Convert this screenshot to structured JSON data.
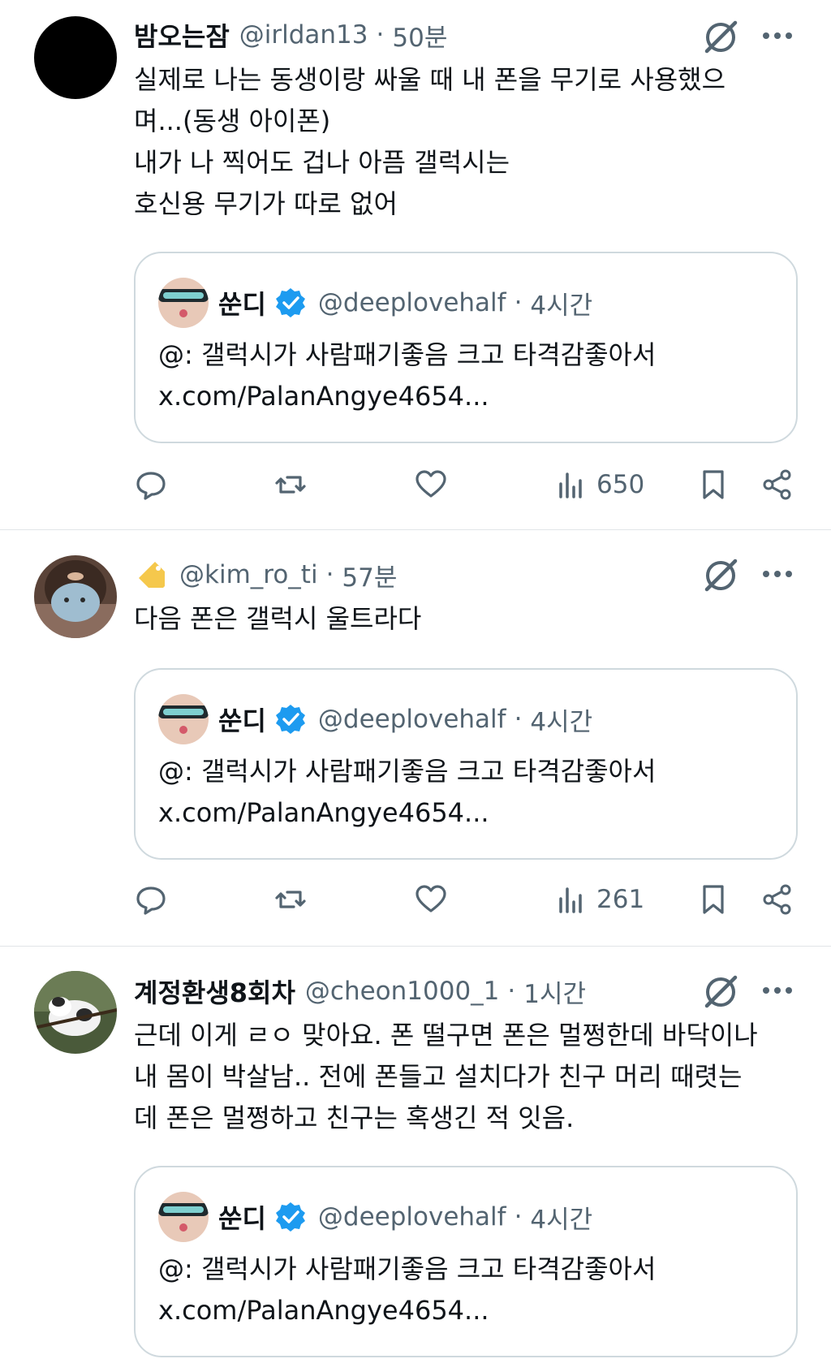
{
  "tweets": [
    {
      "display_name": "밤오는잠",
      "handle": "@irldan13",
      "separator": "·",
      "time": "50분",
      "text": "실제로 나는 동생이랑 싸울 때 내 폰을 무기로 사용했으\n며...(동생 아이폰)\n내가 나 찍어도 겁나 아픔 갤럭시는\n호신용 무기가 따로 없어",
      "avatar_color": "#000000",
      "views": "650",
      "quote": {
        "display_name": "쑨디",
        "handle": "@deeplovehalf",
        "separator": "·",
        "time": "4시간",
        "text": "@: 갤럭시가 사람패기좋음 크고 타격감좋아서\nx.com/PalanAngye4654..."
      }
    },
    {
      "display_name": "",
      "handle": "@kim_ro_ti",
      "separator": "·",
      "time": "57분",
      "text": "다음 폰은 갤럭시 울트라다",
      "name_emoji": "label-tag-icon",
      "views": "261",
      "quote": {
        "display_name": "쑨디",
        "handle": "@deeplovehalf",
        "separator": "·",
        "time": "4시간",
        "text": "@: 갤럭시가 사람패기좋음 크고 타격감좋아서\nx.com/PalanAngye4654..."
      }
    },
    {
      "display_name": "계정환생8회차",
      "handle": "@cheon1000_1",
      "separator": "·",
      "time": "1시간",
      "text": "근데 이게 ㄹㅇ 맞아요. 폰 떨구면 폰은 멀쩡한데 바닥이나\n내 몸이 박살남.. 전에 폰들고 설치다가 친구 머리 때렷는\n데 폰은 멀쩡하고 친구는 혹생긴 적 잇음.",
      "quote": {
        "display_name": "쑨디",
        "handle": "@deeplovehalf",
        "separator": "·",
        "time": "4시간",
        "text": "@: 갤럭시가 사람패기좋음 크고 타격감좋아서\nx.com/PalanAngye4654..."
      }
    }
  ],
  "colors": {
    "text_primary": "#0f1419",
    "text_secondary": "#536471",
    "verified_blue": "#1d9bf0",
    "border": "#cfd9de",
    "divider": "#e1e5e8"
  },
  "icons": {
    "grok": "grok-slash-icon",
    "more": "more-dots-icon",
    "reply": "reply-bubble-icon",
    "retweet": "retweet-icon",
    "like": "heart-icon",
    "views": "views-bar-icon",
    "bookmark": "bookmark-icon",
    "share": "share-icon",
    "verified": "verified-badge-icon"
  }
}
